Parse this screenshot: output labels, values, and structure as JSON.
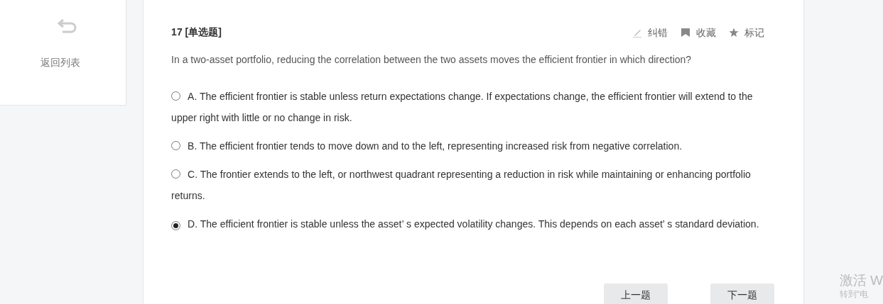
{
  "sidebar": {
    "back_label": "返回列表"
  },
  "question": {
    "number": "17",
    "type": "[单选题]",
    "text": "In a two-asset portfolio, reducing the correlation between the two assets moves the efficient frontier in which direction?"
  },
  "actions": [
    {
      "kind": "pencil",
      "label": "纠错"
    },
    {
      "kind": "bookmark",
      "label": "收藏"
    },
    {
      "kind": "star",
      "label": "标记"
    }
  ],
  "options": [
    {
      "text": "A. The efficient frontier is stable unless return expectations change. If expectations change, the efficient frontier will extend to the upper right with little or no change in risk.",
      "selected": false
    },
    {
      "text": "B. The efficient frontier tends to move down and to the left, representing increased risk from negative correlation.",
      "selected": false
    },
    {
      "text": "C. The frontier extends to the left, or northwest quadrant representing a reduction in risk while maintaining or enhancing portfolio returns.",
      "selected": false
    },
    {
      "text": "D. The efficient frontier is stable unless the asset’ s expected volatility changes. This depends on each asset’ s standard deviation.",
      "selected": true
    }
  ],
  "buttons": [
    "上一题",
    "下一题"
  ],
  "os_notice": [
    "激活 W",
    "转到“电"
  ]
}
